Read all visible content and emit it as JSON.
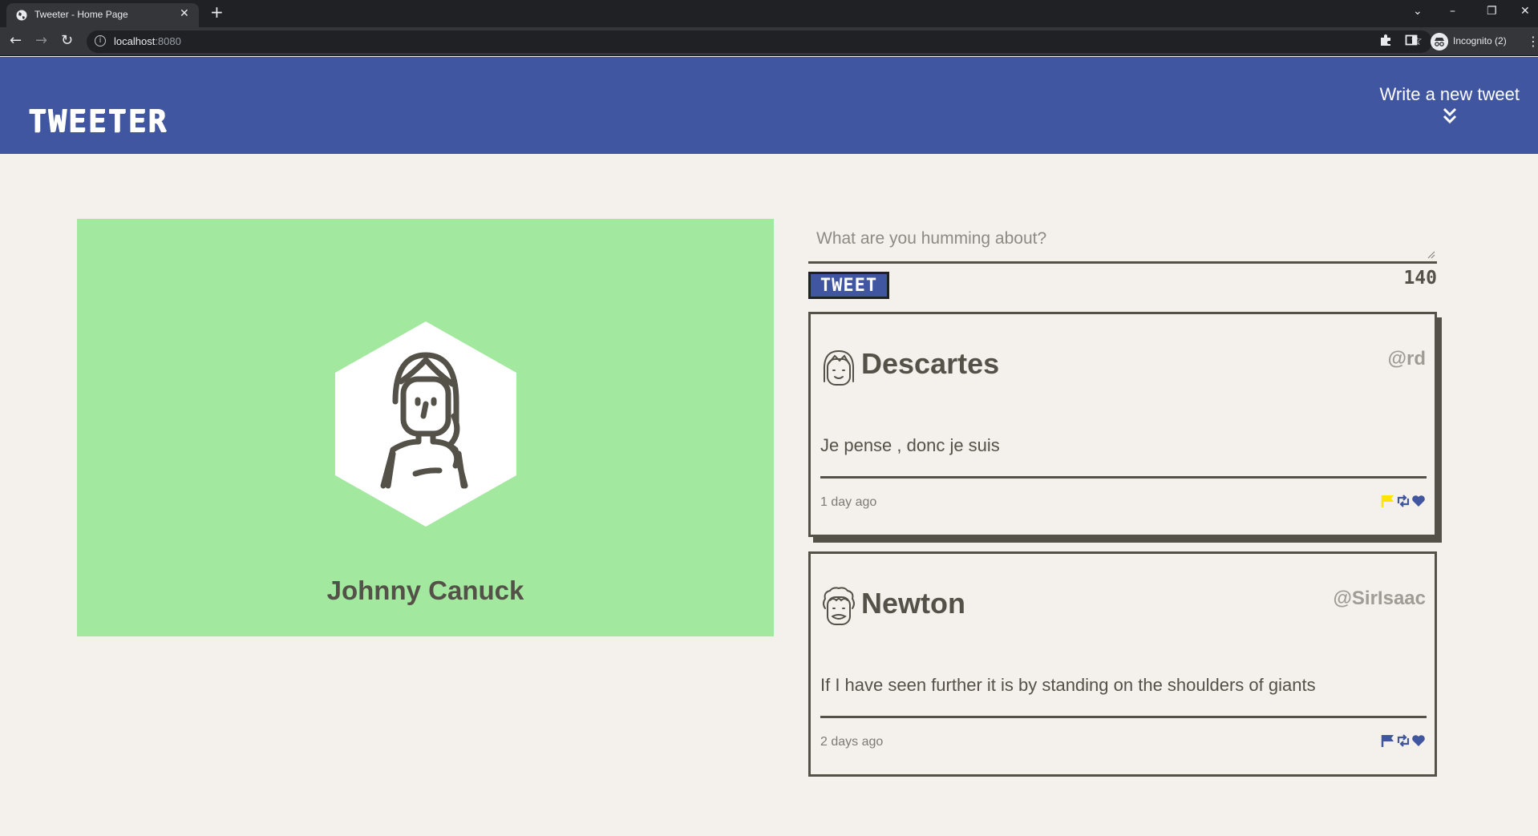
{
  "browser": {
    "tab_title": "Tweeter - Home Page",
    "url_host": "localhost",
    "url_port": ":8080",
    "profile_label": "Incognito (2)"
  },
  "nav": {
    "brand": "TWEETER",
    "write_new": "Write a new tweet"
  },
  "profile": {
    "name": "Johnny Canuck"
  },
  "compose": {
    "placeholder": "What are you humming about?",
    "button_label": "TWEET",
    "counter": "140"
  },
  "tweets": [
    {
      "name": "Descartes",
      "handle": "@rd",
      "text": "Je pense , donc je suis",
      "time": "1 day ago",
      "flag_color": "#ffe400",
      "icon_color": "#4056a1"
    },
    {
      "name": "Newton",
      "handle": "@SirIsaac",
      "text": "If I have seen further it is by standing on the shoulders of giants",
      "time": "2 days ago",
      "flag_color": "#4056a1",
      "icon_color": "#4056a1"
    }
  ],
  "colors": {
    "navbar": "#4056a1",
    "background": "#f4f1ec",
    "profile_panel": "#a2e89e",
    "text": "#545149"
  }
}
